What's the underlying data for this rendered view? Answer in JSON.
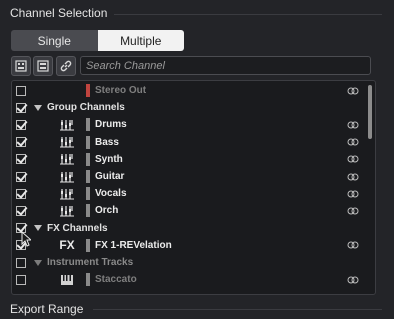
{
  "channel_selection": {
    "title": "Channel Selection",
    "mode_single": "Single",
    "mode_multiple": "Multiple",
    "search_placeholder": "Search Channel"
  },
  "rows": [
    {
      "label": "Stereo Out",
      "checked": false,
      "type": "channel",
      "dim": true,
      "color": "#c0443f"
    },
    {
      "label": "Group Channels",
      "checked": true,
      "type": "group"
    },
    {
      "label": "Drums",
      "checked": true,
      "type": "channel",
      "icon": "group-channel-icon"
    },
    {
      "label": "Bass",
      "checked": true,
      "type": "channel",
      "icon": "group-channel-icon"
    },
    {
      "label": "Synth",
      "checked": true,
      "type": "channel",
      "icon": "group-channel-icon"
    },
    {
      "label": "Guitar",
      "checked": true,
      "type": "channel",
      "icon": "group-channel-icon"
    },
    {
      "label": "Vocals",
      "checked": true,
      "type": "channel",
      "icon": "group-channel-icon"
    },
    {
      "label": "Orch",
      "checked": true,
      "type": "channel",
      "icon": "group-channel-icon"
    },
    {
      "label": "FX Channels",
      "checked": true,
      "type": "group"
    },
    {
      "label": "FX 1-REVelation",
      "checked": true,
      "type": "channel",
      "icon": "fx-icon",
      "icon_text": "FX"
    },
    {
      "label": "Instrument Tracks",
      "checked": false,
      "type": "group",
      "dim": true
    },
    {
      "label": "Staccato",
      "checked": false,
      "type": "channel",
      "dim": true,
      "icon": "instrument-icon"
    }
  ],
  "export_range": {
    "title": "Export Range"
  }
}
